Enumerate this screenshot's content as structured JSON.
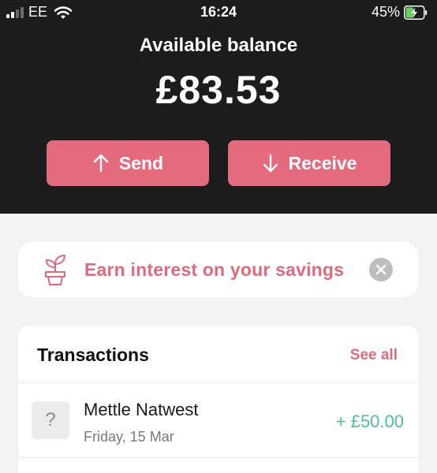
{
  "status_bar": {
    "carrier": "EE",
    "time": "16:24",
    "battery_percent": "45%",
    "battery_level": 0.45,
    "charging": true
  },
  "balance": {
    "label": "Available balance",
    "amount": "£83.53"
  },
  "actions": {
    "send_label": "Send",
    "receive_label": "Receive"
  },
  "promo": {
    "text": "Earn interest on your savings",
    "icon": "plant-pot-icon"
  },
  "transactions": {
    "title": "Transactions",
    "see_all_label": "See all",
    "items": [
      {
        "icon_glyph": "?",
        "name": "Mettle Natwest",
        "date": "Friday, 15 Mar",
        "amount": "+ £50.00"
      }
    ]
  },
  "colors": {
    "accent": "#e46a7d",
    "header_bg": "#1c1c1c",
    "positive": "#4fbf9b",
    "page_bg": "#f3f3f3"
  }
}
